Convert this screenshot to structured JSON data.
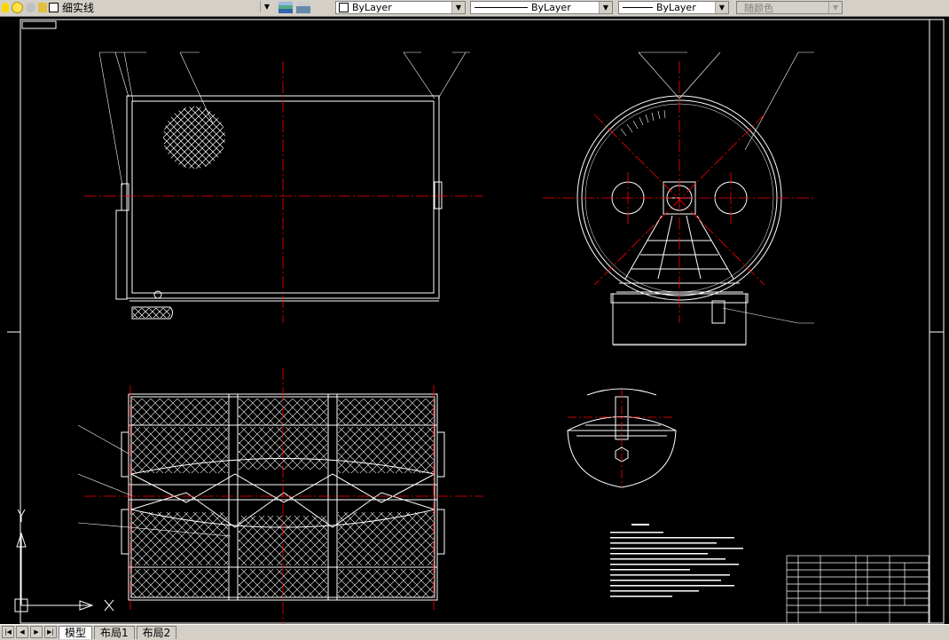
{
  "toolbar": {
    "layer_name": "细实线",
    "color_combo": "ByLayer",
    "linetype_combo": "ByLayer",
    "lineweight_combo": "ByLayer",
    "plotstyle_combo": "随颜色"
  },
  "tabs": [
    {
      "label": "模型",
      "active": true
    },
    {
      "label": "布局1",
      "active": false
    },
    {
      "label": "布局2",
      "active": false
    }
  ],
  "colors": {
    "canvas": "#000000",
    "linework": "#ffffff",
    "centerline": "#ff0000",
    "leader": "#ffffff"
  },
  "icons": [
    "lightbulb-icon",
    "sun-icon",
    "freeze-icon",
    "lock-icon",
    "color-square-icon",
    "layer-manager-icon",
    "layer-previous-icon"
  ]
}
